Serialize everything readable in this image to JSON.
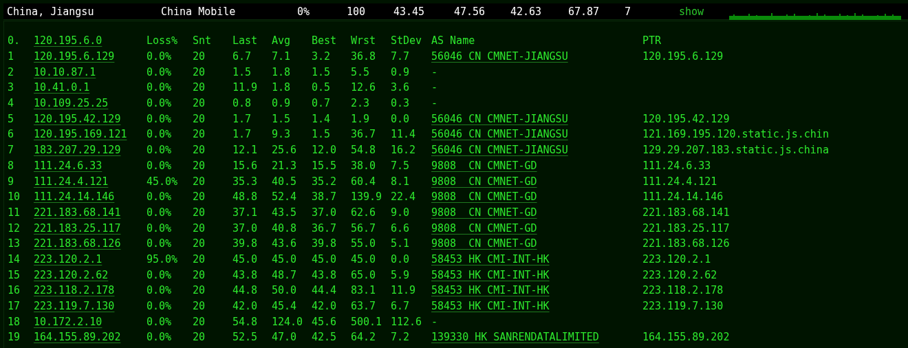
{
  "summary": {
    "fields": [
      "China, Jiangsu",
      "China Mobile",
      "0%",
      "100",
      "43.45",
      "47.56",
      "42.63",
      "67.87",
      "7"
    ],
    "show_link": "show"
  },
  "trace": {
    "hop": "0.",
    "host": "120.195.6.0",
    "columns": [
      "Loss%",
      "Snt",
      "Last",
      "Avg",
      "Best",
      "Wrst",
      "StDev",
      "AS Name",
      "PTR"
    ],
    "rows": [
      {
        "hop": "1",
        "host": "120.195.6.129",
        "loss": "0.0%",
        "snt": "20",
        "last": "6.7",
        "avg": "7.1",
        "best": "3.2",
        "wrst": "36.8",
        "stdev": "7.7",
        "as_name": "56046 CN CMNET-JIANGSU",
        "as_linked": true,
        "ptr": "120.195.6.129"
      },
      {
        "hop": "2",
        "host": "10.10.87.1",
        "loss": "0.0%",
        "snt": "20",
        "last": "1.5",
        "avg": "1.8",
        "best": "1.5",
        "wrst": "5.5",
        "stdev": "0.9",
        "as_name": "-",
        "as_linked": false
      },
      {
        "hop": "3",
        "host": "10.41.0.1",
        "loss": "0.0%",
        "snt": "20",
        "last": "11.9",
        "avg": "1.8",
        "best": "0.5",
        "wrst": "12.6",
        "stdev": "3.6",
        "as_name": "-",
        "as_linked": false
      },
      {
        "hop": "4",
        "host": "10.109.25.25",
        "loss": "0.0%",
        "snt": "20",
        "last": "0.8",
        "avg": "0.9",
        "best": "0.7",
        "wrst": "2.3",
        "stdev": "0.3",
        "as_name": "-",
        "as_linked": false
      },
      {
        "hop": "5",
        "host": "120.195.42.129",
        "loss": "0.0%",
        "snt": "20",
        "last": "1.7",
        "avg": "1.5",
        "best": "1.4",
        "wrst": "1.9",
        "stdev": "0.0",
        "as_name": "56046 CN CMNET-JIANGSU",
        "as_linked": true,
        "ptr": "120.195.42.129"
      },
      {
        "hop": "6",
        "host": "120.195.169.121",
        "loss": "0.0%",
        "snt": "20",
        "last": "1.7",
        "avg": "9.3",
        "best": "1.5",
        "wrst": "36.7",
        "stdev": "11.4",
        "as_name": "56046 CN CMNET-JIANGSU",
        "as_linked": true,
        "ptr": "121.169.195.120.static.js.chin"
      },
      {
        "hop": "7",
        "host": "183.207.29.129",
        "loss": "0.0%",
        "snt": "20",
        "last": "12.1",
        "avg": "25.6",
        "best": "12.0",
        "wrst": "54.8",
        "stdev": "16.2",
        "as_name": "56046 CN CMNET-JIANGSU",
        "as_linked": true,
        "ptr": "129.29.207.183.static.js.china"
      },
      {
        "hop": "8",
        "host": "111.24.6.33",
        "loss": "0.0%",
        "snt": "20",
        "last": "15.6",
        "avg": "21.3",
        "best": "15.5",
        "wrst": "38.0",
        "stdev": "7.5",
        "as_name": "9808  CN CMNET-GD",
        "as_linked": true,
        "ptr": "111.24.6.33"
      },
      {
        "hop": "9",
        "host": "111.24.4.121",
        "loss": "45.0%",
        "snt": "20",
        "last": "35.3",
        "avg": "40.5",
        "best": "35.2",
        "wrst": "60.4",
        "stdev": "8.1",
        "as_name": "9808  CN CMNET-GD",
        "as_linked": true,
        "ptr": "111.24.4.121"
      },
      {
        "hop": "10",
        "host": "111.24.14.146",
        "loss": "0.0%",
        "snt": "20",
        "last": "48.8",
        "avg": "52.4",
        "best": "38.7",
        "wrst": "139.9",
        "stdev": "22.4",
        "as_name": "9808  CN CMNET-GD",
        "as_linked": true,
        "ptr": "111.24.14.146"
      },
      {
        "hop": "11",
        "host": "221.183.68.141",
        "loss": "0.0%",
        "snt": "20",
        "last": "37.1",
        "avg": "43.5",
        "best": "37.0",
        "wrst": "62.6",
        "stdev": "9.0",
        "as_name": "9808  CN CMNET-GD",
        "as_linked": true,
        "ptr": "221.183.68.141"
      },
      {
        "hop": "12",
        "host": "221.183.25.117",
        "loss": "0.0%",
        "snt": "20",
        "last": "37.0",
        "avg": "40.8",
        "best": "36.7",
        "wrst": "56.7",
        "stdev": "6.6",
        "as_name": "9808  CN CMNET-GD",
        "as_linked": true,
        "ptr": "221.183.25.117"
      },
      {
        "hop": "13",
        "host": "221.183.68.126",
        "loss": "0.0%",
        "snt": "20",
        "last": "39.8",
        "avg": "43.6",
        "best": "39.8",
        "wrst": "55.0",
        "stdev": "5.1",
        "as_name": "9808  CN CMNET-GD",
        "as_linked": true,
        "ptr": "221.183.68.126"
      },
      {
        "hop": "14",
        "host": "223.120.2.1",
        "loss": "95.0%",
        "snt": "20",
        "last": "45.0",
        "avg": "45.0",
        "best": "45.0",
        "wrst": "45.0",
        "stdev": "0.0",
        "as_name": "58453 HK CMI-INT-HK",
        "as_linked": true,
        "ptr": "223.120.2.1"
      },
      {
        "hop": "15",
        "host": "223.120.2.62",
        "loss": "0.0%",
        "snt": "20",
        "last": "43.8",
        "avg": "48.7",
        "best": "43.8",
        "wrst": "65.0",
        "stdev": "5.9",
        "as_name": "58453 HK CMI-INT-HK",
        "as_linked": true,
        "ptr": "223.120.2.62"
      },
      {
        "hop": "16",
        "host": "223.118.2.178",
        "loss": "0.0%",
        "snt": "20",
        "last": "44.8",
        "avg": "50.0",
        "best": "44.4",
        "wrst": "83.1",
        "stdev": "11.9",
        "as_name": "58453 HK CMI-INT-HK",
        "as_linked": true,
        "ptr": "223.118.2.178"
      },
      {
        "hop": "17",
        "host": "223.119.7.130",
        "loss": "0.0%",
        "snt": "20",
        "last": "42.0",
        "avg": "45.4",
        "best": "42.0",
        "wrst": "63.7",
        "stdev": "6.7",
        "as_name": "58453 HK CMI-INT-HK",
        "as_linked": true,
        "ptr": "223.119.7.130"
      },
      {
        "hop": "18",
        "host": "10.172.2.10",
        "loss": "0.0%",
        "snt": "20",
        "last": "54.8",
        "avg": "124.0",
        "best": "45.6",
        "wrst": "500.1",
        "stdev": "112.6",
        "as_name": "-",
        "as_linked": false
      },
      {
        "hop": "19",
        "host": "164.155.89.202",
        "loss": "0.0%",
        "snt": "20",
        "last": "52.5",
        "avg": "47.0",
        "best": "42.5",
        "wrst": "64.2",
        "stdev": "7.2",
        "as_name": "139330 HK SANRENDATALIMITED",
        "as_linked": true,
        "ptr": "164.155.89.202"
      }
    ]
  }
}
